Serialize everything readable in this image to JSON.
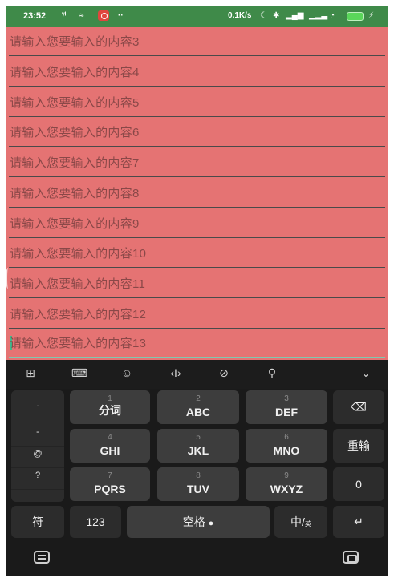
{
  "status_bar": {
    "time": "23:52",
    "network_speed": "0.1K/s",
    "battery_color": "#5ad65a",
    "bar_color": "#3f8a49",
    "icons": [
      "signal-icon",
      "wifi-icon",
      "notification-icon",
      "more-icon",
      "alarm-icon",
      "bluetooth-icon",
      "cell-signal-icon",
      "wifi-icon",
      "battery-icon",
      "charging-icon"
    ]
  },
  "fields": [
    {
      "placeholder": "请输入您要输入的内容3"
    },
    {
      "placeholder": "请输入您要输入的内容4"
    },
    {
      "placeholder": "请输入您要输入的内容5"
    },
    {
      "placeholder": "请输入您要输入的内容6"
    },
    {
      "placeholder": "请输入您要输入的内容7"
    },
    {
      "placeholder": "请输入您要输入的内容8"
    },
    {
      "placeholder": "请输入您要输入的内容9"
    },
    {
      "placeholder": "请输入您要输入的内容10"
    },
    {
      "placeholder": "请输入您要输入的内容11"
    },
    {
      "placeholder": "请输入您要输入的内容12"
    },
    {
      "placeholder": "请输入您要输入的内容13"
    }
  ],
  "content_background": "#e57373",
  "keyboard": {
    "toolbar_icons": [
      "apps-grid-icon",
      "keyboard-layout-icon",
      "emoji-icon",
      "cursor-move-icon",
      "link-icon",
      "search-icon",
      "collapse-chevron-icon"
    ],
    "symbols": [
      ".",
      "-",
      "@",
      "?",
      ""
    ],
    "keys": {
      "k1": {
        "num": "1",
        "label": "分词"
      },
      "k2": {
        "num": "2",
        "label": "ABC"
      },
      "k3": {
        "num": "3",
        "label": "DEF"
      },
      "k4": {
        "num": "4",
        "label": "GHI"
      },
      "k5": {
        "num": "5",
        "label": "JKL"
      },
      "k6": {
        "num": "6",
        "label": "MNO"
      },
      "k7": {
        "num": "7",
        "label": "PQRS"
      },
      "k8": {
        "num": "8",
        "label": "TUV"
      },
      "k9": {
        "num": "9",
        "label": "WXYZ"
      }
    },
    "backspace_icon": "⌫",
    "reinput_label": "重输",
    "zero_label": "0",
    "symbol_label": "符",
    "numbers_label": "123",
    "space_label": "空格",
    "lang_label": "中",
    "lang_sub": "英",
    "enter_icon": "↵"
  },
  "nav_bar": {
    "icons": [
      "keyboard-icon",
      "recents-icon"
    ]
  }
}
